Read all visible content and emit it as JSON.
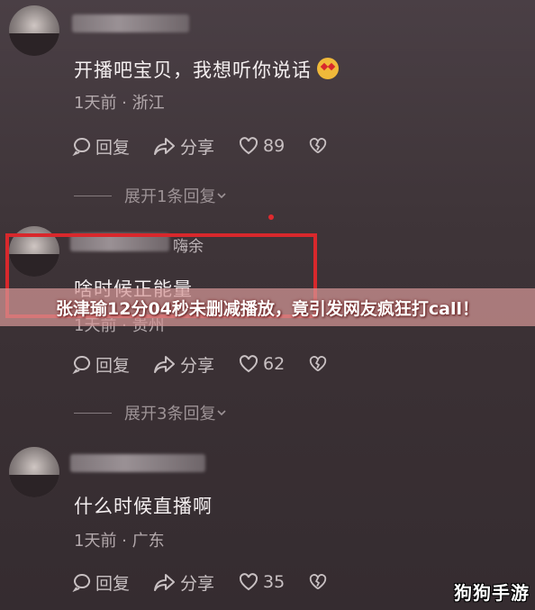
{
  "comments": [
    {
      "text": "开播吧宝贝，我想听你说话",
      "meta": "1天前 · 浙江",
      "reply": "回复",
      "share": "分享",
      "likes": "89",
      "expand": "展开1条回复"
    },
    {
      "name_suffix": "嗨余",
      "text": "啥时候正能量",
      "meta": "1天前 · 贵州",
      "reply": "回复",
      "share": "分享",
      "likes": "62",
      "expand": "展开3条回复"
    },
    {
      "text": "什么时候直播啊",
      "meta": "1天前 · 广东",
      "reply": "回复",
      "share": "分享",
      "likes": "35"
    }
  ],
  "banner": "张津瑜12分04秒未删减播放，竟引发网友疯狂打call！",
  "watermark": "狗狗手游",
  "colors": {
    "highlight": "#d8282c",
    "banner_bg": "#d49696"
  }
}
